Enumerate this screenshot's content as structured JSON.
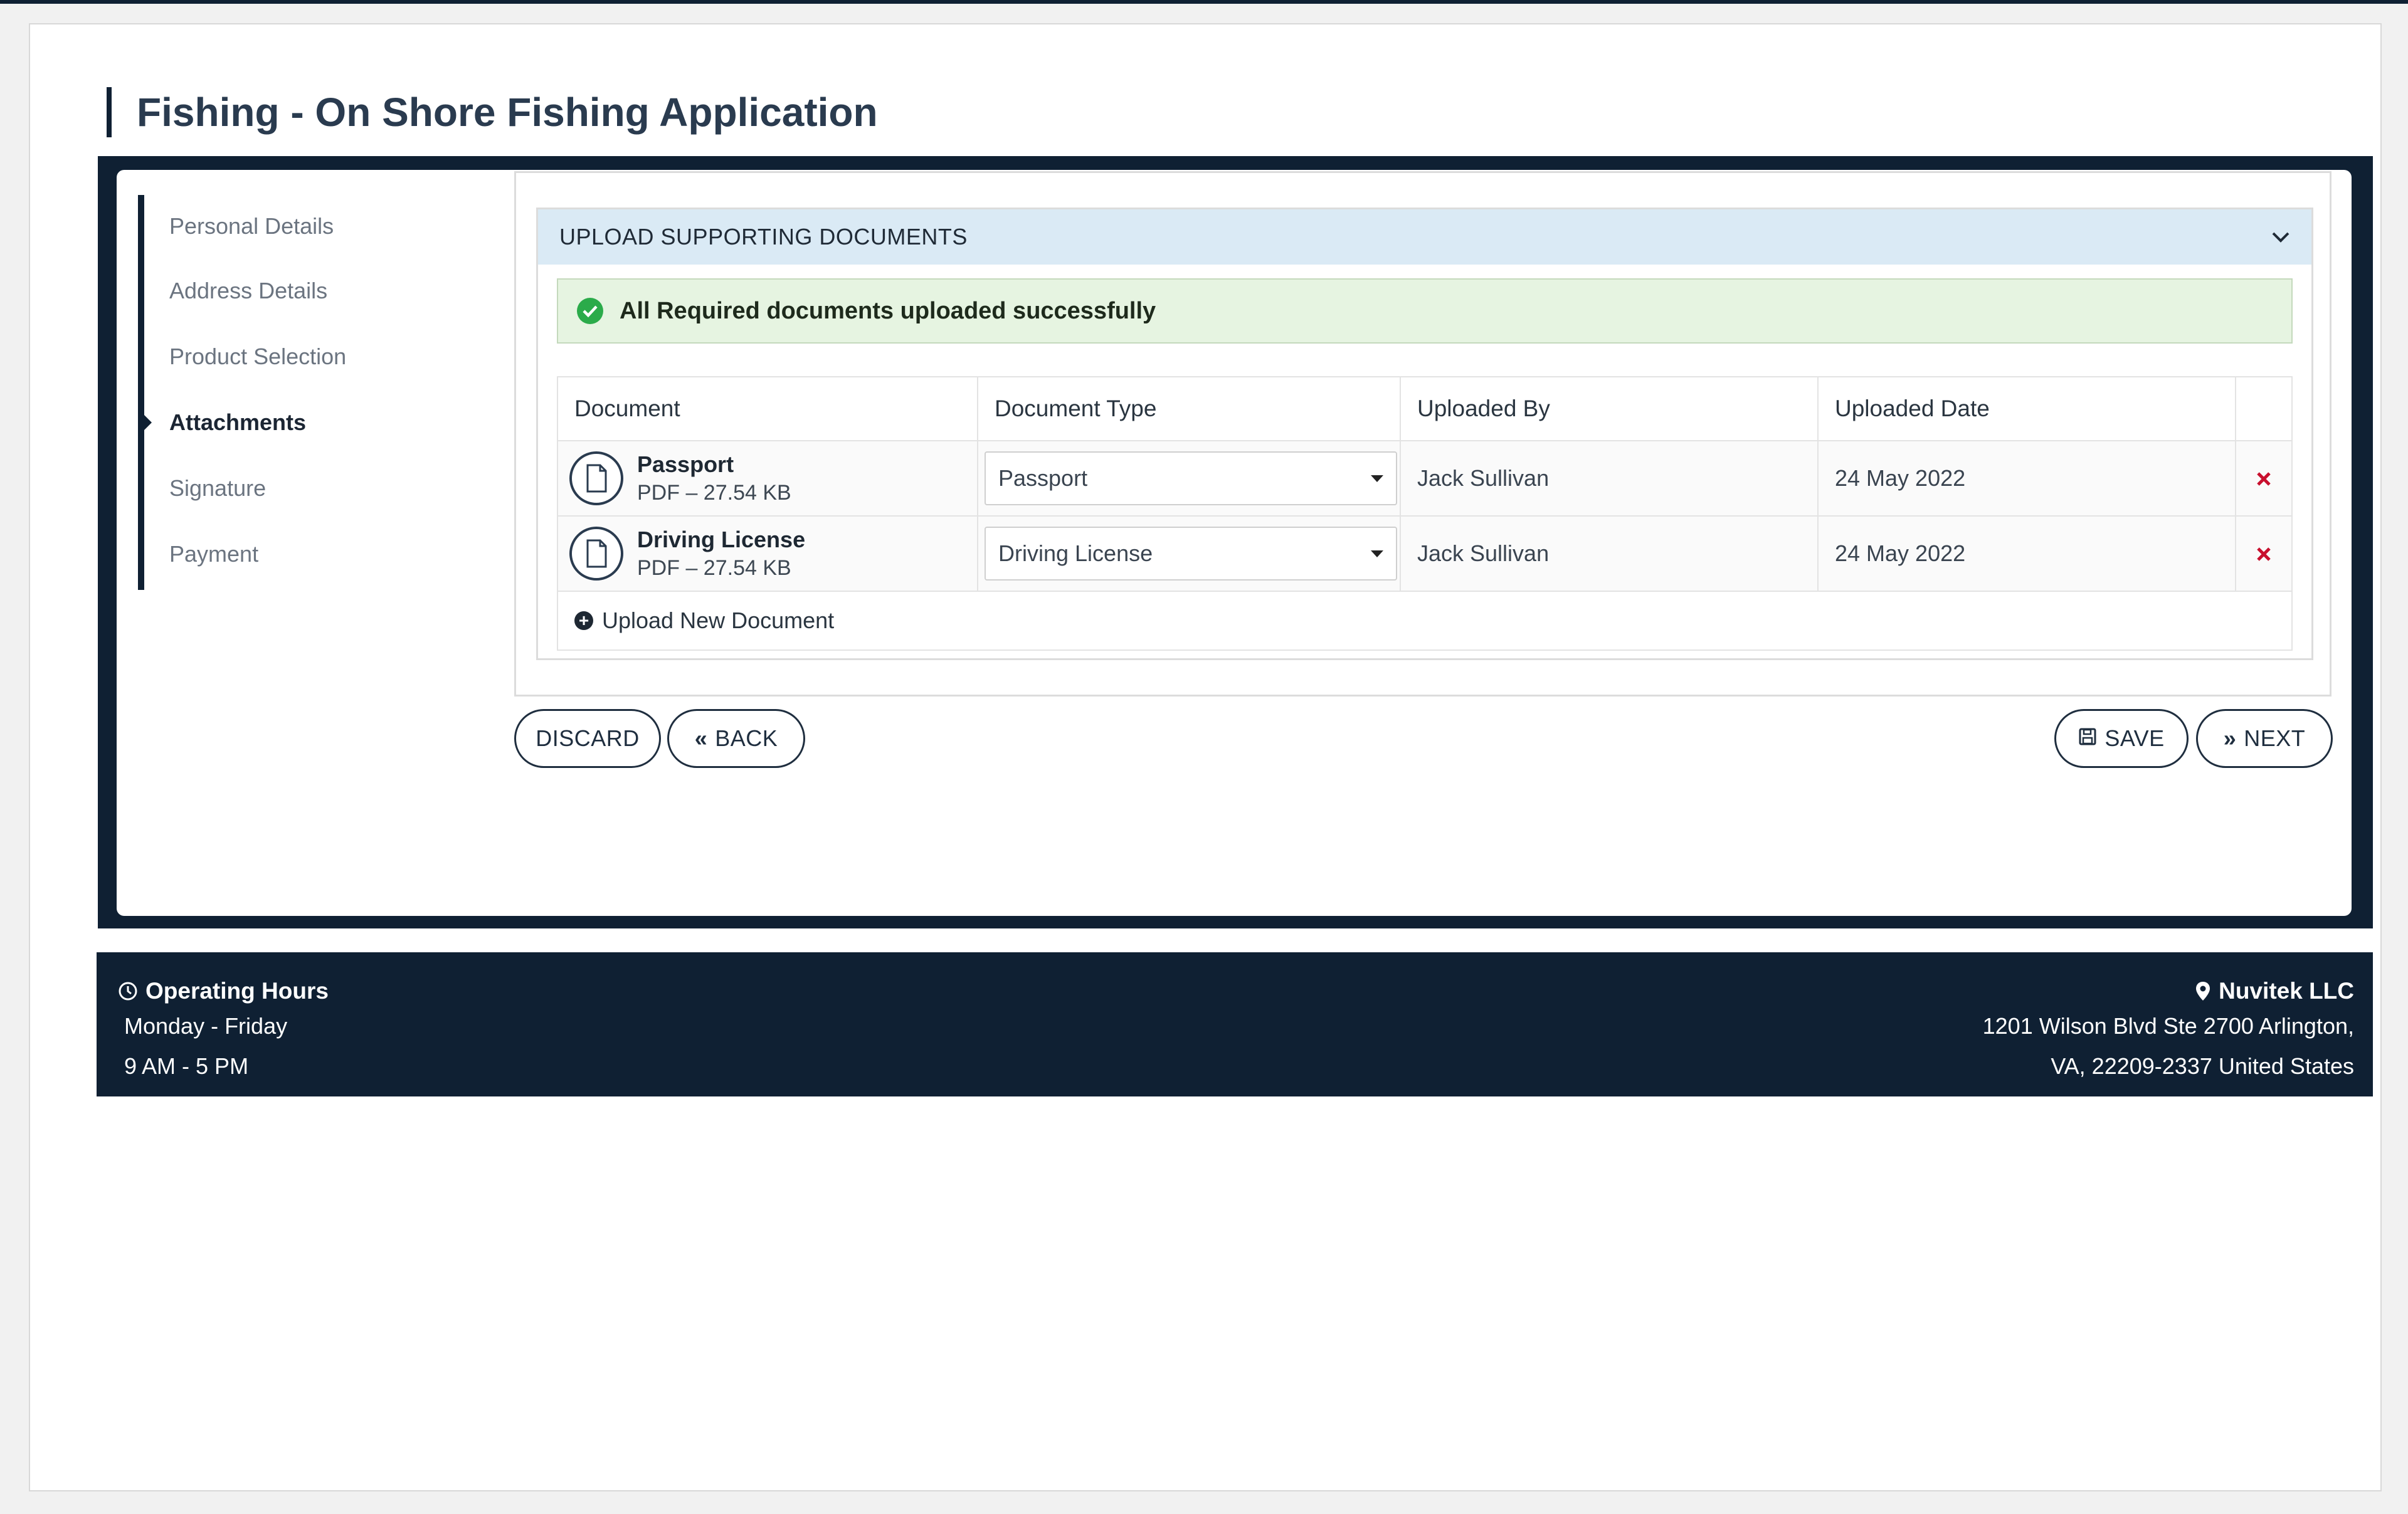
{
  "page": {
    "title": "Fishing - On Shore Fishing Application"
  },
  "steps": [
    {
      "label": "Personal Details"
    },
    {
      "label": "Address Details"
    },
    {
      "label": "Product Selection"
    },
    {
      "label": "Attachments"
    },
    {
      "label": "Signature"
    },
    {
      "label": "Payment"
    }
  ],
  "upload": {
    "header": "UPLOAD SUPPORTING DOCUMENTS",
    "alert": "All Required documents uploaded successfully",
    "columns": [
      "Document",
      "Document Type",
      "Uploaded By",
      "Uploaded Date"
    ],
    "rows": [
      {
        "name": "Passport",
        "meta": "PDF – 27.54 KB",
        "type": "Passport",
        "by": "Jack Sullivan",
        "date": "24 May 2022"
      },
      {
        "name": "Driving License",
        "meta": "PDF – 27.54 KB",
        "type": "Driving License",
        "by": "Jack Sullivan",
        "date": "24 May 2022"
      }
    ],
    "upload_new": "Upload New Document"
  },
  "buttons": {
    "discard": "DISCARD",
    "back": "BACK",
    "save": "SAVE",
    "next": "NEXT"
  },
  "footer": {
    "hours_title": "Operating Hours",
    "hours_days": "Monday - Friday",
    "hours_time": "9 AM - 5 PM",
    "company": "Nuvitek LLC",
    "address_line1": "1201 Wilson Blvd Ste 2700 Arlington,",
    "address_line2": "VA, 22209-2337 United States"
  },
  "icons": {
    "step_caret": "caret-right-icon",
    "collapse": "chevron-down-icon",
    "success": "check-circle-icon",
    "document": "file-icon",
    "delete": "close-icon",
    "add": "plus-circle-icon",
    "clock": "clock-icon",
    "location": "map-marker-icon"
  },
  "colors": {
    "navy": "#0f2033",
    "success": "#2bab4a",
    "danger": "#c8102e",
    "header_blue": "#daeaf5"
  }
}
